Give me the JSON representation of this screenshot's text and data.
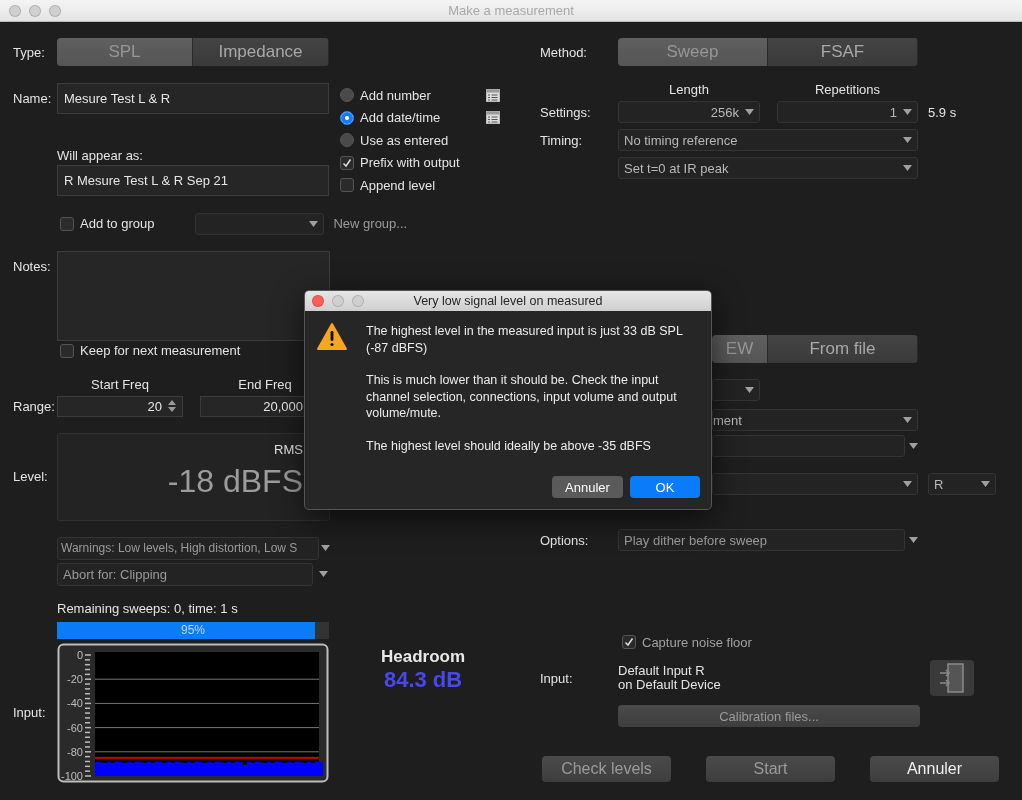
{
  "window": {
    "title": "Make a measurement"
  },
  "type": {
    "label": "Type:",
    "options": [
      {
        "label": "SPL",
        "selected": true
      },
      {
        "label": "Impedance",
        "selected": false
      }
    ]
  },
  "name": {
    "label": "Name:",
    "value": "Mesure Test L & R"
  },
  "name_options": [
    {
      "kind": "radio",
      "label": "Add number",
      "checked": false,
      "list_icon": true
    },
    {
      "kind": "radio",
      "label": "Add date/time",
      "checked": true,
      "list_icon": true
    },
    {
      "kind": "radio",
      "label": "Use as entered",
      "checked": false,
      "list_icon": false
    },
    {
      "kind": "checkbox",
      "label": "Prefix with output",
      "checked": true,
      "list_icon": false
    },
    {
      "kind": "checkbox",
      "label": "Append level",
      "checked": false,
      "list_icon": false
    }
  ],
  "preview": {
    "label": "Will appear as:",
    "value": "R Mesure Test L & R Sep 21"
  },
  "group": {
    "label": "Add to group",
    "checked": false,
    "link": "New group..."
  },
  "notes": {
    "label": "Notes:",
    "keep_label": "Keep for next measurement",
    "keep_checked": false
  },
  "range": {
    "label": "Range:",
    "start": {
      "header": "Start Freq",
      "value": "20"
    },
    "end": {
      "header": "End Freq",
      "value": "20,000"
    }
  },
  "level": {
    "label": "Level:",
    "mode": "RMS",
    "value": "-18 dBFS"
  },
  "warnings": "Warnings: Low levels, High distortion, Low S",
  "abort": "Abort for: Clipping",
  "progress": {
    "text": "Remaining sweeps: 0, time: 1 s",
    "level": 0.95,
    "label": "95%"
  },
  "input_meter": {
    "label": "Input:",
    "ticks": [
      "0",
      "-20",
      "-40",
      "-60",
      "-80",
      "-100"
    ]
  },
  "headroom": {
    "title": "Headroom",
    "value": "84.3 dB"
  },
  "method": {
    "label": "Method:",
    "options": [
      {
        "label": "Sweep",
        "selected": true
      },
      {
        "label": "FSAF",
        "selected": false
      }
    ]
  },
  "settings": {
    "label": "Settings:",
    "length": {
      "header": "Length",
      "value": "256k"
    },
    "repetitions": {
      "header": "Repetitions",
      "value": "1"
    },
    "duration": "5.9 s"
  },
  "timing": {
    "label": "Timing:",
    "reference": "No timing reference",
    "zero": "Set t=0 at IR peak"
  },
  "partly_hidden": {
    "source_tabs": [
      {
        "label": "EW",
        "selected": true
      },
      {
        "label": "From file",
        "selected": false
      }
    ],
    "dropdown": "ment",
    "channel": "R"
  },
  "options": {
    "label": "Options:",
    "value": "Play dither before sweep"
  },
  "capture_noise": {
    "label": "Capture noise floor",
    "checked": true,
    "disabled": true
  },
  "input": {
    "label": "Input:",
    "line_1": "Default Input R",
    "line_2": "on Default Device"
  },
  "calibration": "Calibration files...",
  "buttons": [
    {
      "label": "Check levels",
      "disabled": true
    },
    {
      "label": "Start",
      "disabled": true
    },
    {
      "label": "Annuler",
      "disabled": false
    }
  ],
  "dialog": {
    "title": "Very low signal level on measured",
    "paragraphs": [
      "The highest level in the measured input is just 33 dB SPL (-87 dBFS)",
      "This is much lower than it should be. Check the input channel selection, connections, input volume and output volume/mute.",
      "The highest level should ideally be above -35 dBFS"
    ],
    "buttons": [
      {
        "label": "Annuler",
        "default": false
      },
      {
        "label": "OK",
        "default": true
      }
    ]
  }
}
